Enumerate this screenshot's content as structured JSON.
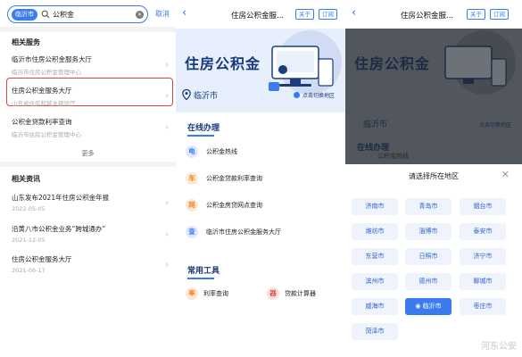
{
  "search": {
    "city_chip": "临沂市",
    "value": "公积金",
    "cancel": "取消"
  },
  "services_section": {
    "title": "相关服务",
    "items": [
      {
        "title": "临沂市住房公积金服务大厅",
        "subtitle": "临沂市住房公积金管理中心"
      },
      {
        "title": "住房公积金服务大厅",
        "subtitle": "山东省住房和城乡建设厅"
      },
      {
        "title": "公积金贷款利率查询",
        "subtitle": "临沂市住房公积金管理中心"
      }
    ],
    "more": "更多"
  },
  "news_section": {
    "title": "相关资讯",
    "items": [
      {
        "title": "山东发布2021年住房公积金年报",
        "date": "2022-05-05"
      },
      {
        "title": "沿黄八市公积金业务“跨城通办”",
        "date": "2021-12-05"
      },
      {
        "title": "住房公积金服务大厅",
        "date": "2021-06-17"
      }
    ]
  },
  "service_page": {
    "title": "住房公积金服...",
    "follow_btn": "关于",
    "subscribe_btn": "订阅",
    "hero_title": "住房公积金",
    "location": "临沂市",
    "switch_label": "点击切换地区",
    "online_title": "在线办理",
    "online_items": [
      {
        "icon": "电",
        "label": "公积金热线"
      },
      {
        "icon": "车",
        "label": "公积金贷款利率查询"
      },
      {
        "icon": "网",
        "label": "公积金房贷网点查询"
      },
      {
        "icon": "查",
        "label": "临沂市住房公积金服务大厅"
      }
    ],
    "tools_title": "常用工具",
    "tools": [
      {
        "icon": "率",
        "label": "利率查询"
      },
      {
        "icon": "器",
        "label": "贷款计算器"
      }
    ]
  },
  "region_picker": {
    "title": "请选择所在地区",
    "cities": [
      "济南市",
      "青岛市",
      "烟台市",
      "潍坊市",
      "淄博市",
      "泰安市",
      "东营市",
      "日照市",
      "济宁市",
      "滨州市",
      "德州市",
      "聊城市",
      "威海市",
      "临沂市",
      "枣庄市",
      "菏泽市"
    ],
    "selected": "临沂市"
  },
  "watermark": "河东公安",
  "colors": {
    "accent": "#3b7bf0",
    "highlight_border": "#e0443f",
    "hero_text": "#173a78"
  }
}
